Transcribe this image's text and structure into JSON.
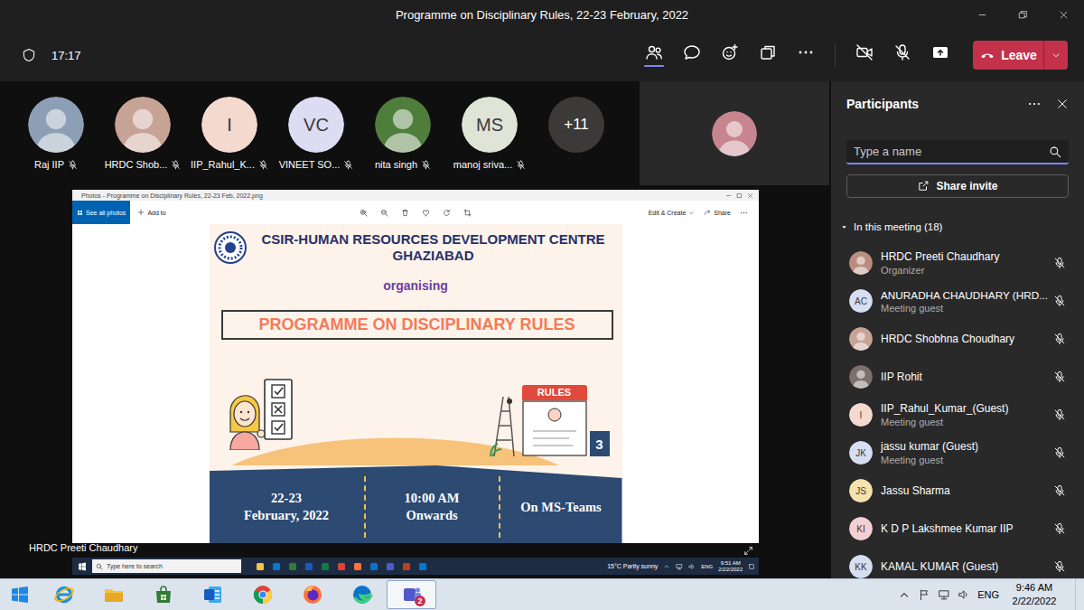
{
  "window": {
    "title": "Programme on Disciplinary Rules, 22-23 February, 2022"
  },
  "toolbar": {
    "time": "17:17",
    "tools": [
      {
        "kind": "people",
        "selected": true
      },
      {
        "kind": "chat",
        "selected": false
      },
      {
        "kind": "react",
        "selected": false
      },
      {
        "kind": "rooms",
        "selected": false
      },
      {
        "kind": "more",
        "selected": false
      },
      {
        "kind": "camera-off",
        "selected": false
      },
      {
        "kind": "mic-off",
        "selected": false
      },
      {
        "kind": "share",
        "selected": false
      }
    ],
    "leave": "Leave"
  },
  "stage": {
    "tiles": [
      {
        "name": "Raj IIP",
        "kind": "photo",
        "color": "#8c9fb4",
        "muted": true
      },
      {
        "name": "HRDC Shob...",
        "kind": "photo",
        "color": "#c7a396",
        "muted": true
      },
      {
        "name": "IIP_Rahul_K...",
        "kind": "initials",
        "initials": "I",
        "color": "#f4d9cf",
        "muted": true
      },
      {
        "name": "VINEET SO...",
        "kind": "initials",
        "initials": "VC",
        "color": "#dcdcf2",
        "muted": true
      },
      {
        "name": "nita singh",
        "kind": "photo",
        "color": "#4f7d3c",
        "muted": true
      },
      {
        "name": "manoj sriva...",
        "kind": "initials",
        "initials": "MS",
        "color": "#dfe4d6",
        "muted": true
      }
    ],
    "overflow": "+11",
    "presenter": "HRDC Preeti Chaudhary"
  },
  "shared_screen": {
    "photos": {
      "title": "Photos - Programme on Disciplinary Rules, 22-23 Feb, 2022.png",
      "see_all": "See all photos",
      "add_to": "Add to",
      "edit_create": "Edit & Create",
      "share": "Share"
    },
    "poster": {
      "org": "CSIR-HUMAN RESOURCES DEVELOPMENT CENTRE",
      "city": "GHAZIABAD",
      "organising": "organising",
      "title": "PROGRAMME ON DISCIPLINARY RULES",
      "sign": "RULES",
      "step": "3",
      "details": [
        [
          "22-23",
          "February, 2022"
        ],
        [
          "10:00 AM",
          "Onwards"
        ],
        [
          "On MS-Teams"
        ]
      ]
    },
    "taskbar": {
      "search": "Type here to search",
      "weather": "15°C Partly sunny",
      "lang": "ENG",
      "time": "9:51 AM",
      "date": "2/22/2022"
    }
  },
  "participants": {
    "title": "Participants",
    "search_placeholder": "Type a name",
    "share_invite": "Share invite",
    "section": {
      "label": "In this meeting (18)",
      "expanded": true
    },
    "people": [
      {
        "name": "HRDC Preeti Chaudhary",
        "role": "Organizer",
        "kind": "photo",
        "color": "#b98e80",
        "muted": true
      },
      {
        "name": "ANURADHA CHAUDHARY (HRD...",
        "role": "Meeting guest",
        "kind": "initials",
        "initials": "AC",
        "color": "#d6def2",
        "muted": true
      },
      {
        "name": "HRDC Shobhna Choudhary",
        "kind": "photo",
        "color": "#c7a396",
        "muted": true
      },
      {
        "name": "IIP Rohit",
        "kind": "photo",
        "color": "#7d6f69",
        "muted": true
      },
      {
        "name": "IIP_Rahul_Kumar_(Guest)",
        "role": "Meeting guest",
        "kind": "initials",
        "initials": "I",
        "color": "#f4d9cf",
        "muted": true
      },
      {
        "name": "jassu kumar (Guest)",
        "role": "Meeting guest",
        "kind": "initials",
        "initials": "JK",
        "color": "#d6def2",
        "muted": true
      },
      {
        "name": "Jassu Sharma",
        "kind": "initials",
        "initials": "JS",
        "color": "#f6e2ae",
        "muted": true
      },
      {
        "name": "K D P Lakshmee Kumar IIP",
        "kind": "initials",
        "initials": "KI",
        "color": "#f3d0d4",
        "muted": true
      },
      {
        "name": "KAMAL KUMAR (Guest)",
        "kind": "initials",
        "initials": "KK",
        "color": "#d6def2",
        "muted": true
      }
    ]
  },
  "taskbar": {
    "apps": [
      {
        "kind": "start",
        "selected": false
      },
      {
        "kind": "ie",
        "selected": false
      },
      {
        "kind": "explorer",
        "selected": false
      },
      {
        "kind": "store",
        "selected": false
      },
      {
        "kind": "word",
        "selected": false
      },
      {
        "kind": "chrome",
        "selected": false
      },
      {
        "kind": "firefox",
        "selected": false
      },
      {
        "kind": "edge",
        "selected": false
      },
      {
        "kind": "teams",
        "selected": true,
        "badge": "2"
      }
    ],
    "lang": "ENG",
    "time": "9:46 AM",
    "date": "2/22/2022"
  }
}
